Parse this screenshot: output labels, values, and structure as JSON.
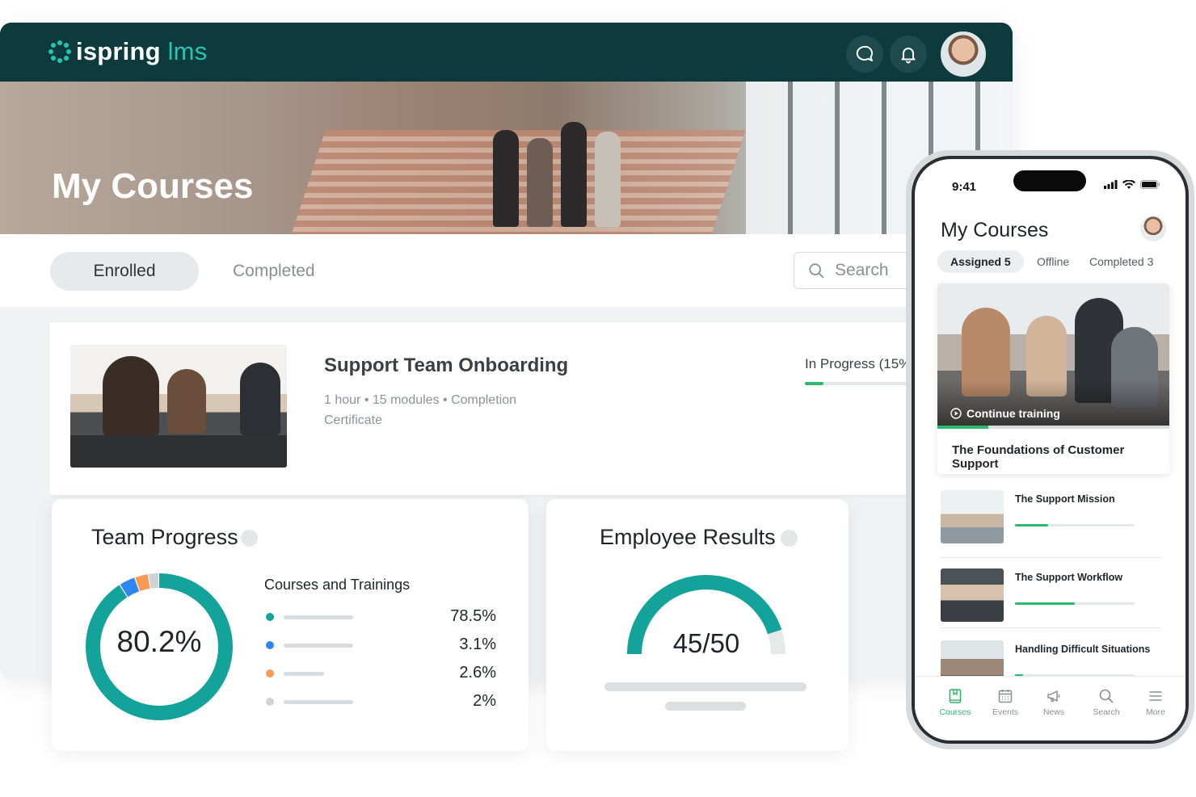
{
  "app": {
    "brand_main": "ispring",
    "brand_sub": "lms"
  },
  "colors": {
    "teal": "#0c3a3d",
    "accent": "#25c5b4",
    "green": "#2fb86b",
    "donut_teal": "#14a39a",
    "blue": "#2e86f0",
    "orange": "#f79a54",
    "grey": "#cfd2d5"
  },
  "topbar": {
    "icons": [
      "chat-icon",
      "bell-icon"
    ],
    "avatar": "user-avatar"
  },
  "hero": {
    "title": "My Courses"
  },
  "tabs": {
    "enrolled": "Enrolled",
    "completed": "Completed"
  },
  "search": {
    "placeholder": "Search"
  },
  "course": {
    "title": "Support Team Onboarding",
    "meta_line1": "1 hour  •  15 modules  •  Completion",
    "meta_line2": "Certificate",
    "status": "In Progress (15%)",
    "progress": 0.15
  },
  "team_progress": {
    "title": "Team Progress",
    "value": "80.2%",
    "legend_title": "Courses and Trainings",
    "segments": [
      {
        "color": "#14a39a",
        "percent": 78.5,
        "label": "78.5%"
      },
      {
        "color": "#2e86f0",
        "percent": 3.1,
        "label": "3.1%"
      },
      {
        "color": "#f79a54",
        "percent": 2.6,
        "label": "2.6%"
      },
      {
        "color": "#cfd2d5",
        "percent": 2.0,
        "label": "2%"
      }
    ]
  },
  "employee_results": {
    "title": "Employee Results",
    "value": "45/50",
    "score": 45,
    "max": 50
  },
  "mobile": {
    "time": "9:41",
    "title": "My Courses",
    "tabs": [
      "Assigned 5",
      "Offline",
      "Completed 3"
    ],
    "featured": {
      "cta": "Continue training",
      "title": "The Foundations of Customer Support",
      "progress": 0.22
    },
    "items": [
      {
        "title": "The Support Mission",
        "progress": 0.28
      },
      {
        "title": "The Support Workflow",
        "progress": 0.5
      },
      {
        "title": "Handling Difficult Situations",
        "progress": 0.07
      }
    ],
    "nav": [
      "Courses",
      "Events",
      "News",
      "Search",
      "More"
    ]
  }
}
